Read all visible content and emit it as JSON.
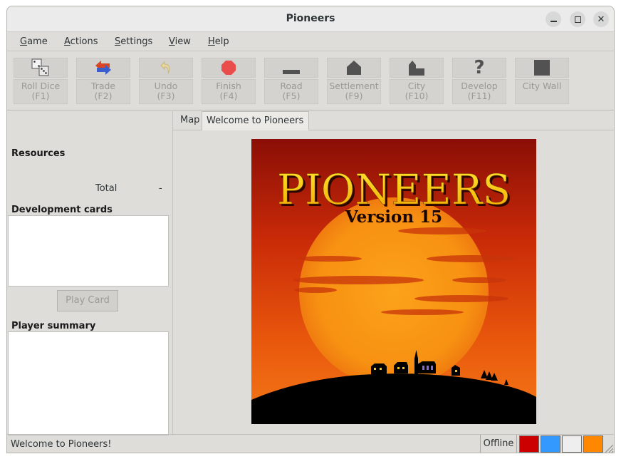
{
  "window": {
    "title": "Pioneers"
  },
  "menubar": {
    "items": [
      "Game",
      "Actions",
      "Settings",
      "View",
      "Help"
    ]
  },
  "toolbar": {
    "buttons": [
      {
        "line1": "Roll Dice",
        "line2": "(F1)",
        "icon": "dice-icon"
      },
      {
        "line1": "Trade",
        "line2": "(F2)",
        "icon": "trade-arrows-icon"
      },
      {
        "line1": "Undo",
        "line2": "(F3)",
        "icon": "undo-arrow-icon"
      },
      {
        "line1": "Finish",
        "line2": "(F4)",
        "icon": "stop-octagon-icon"
      },
      {
        "line1": "Road",
        "line2": "(F5)",
        "icon": "road-icon"
      },
      {
        "line1": "Settlement",
        "line2": "(F9)",
        "icon": "settlement-icon"
      },
      {
        "line1": "City",
        "line2": "(F10)",
        "icon": "city-icon"
      },
      {
        "line1": "Develop",
        "line2": "(F11)",
        "icon": "question-mark-icon"
      },
      {
        "line1": "City Wall",
        "line2": "",
        "icon": "city-wall-icon"
      }
    ]
  },
  "sidebar": {
    "resources_title": "Resources",
    "total_label": "Total",
    "total_value": "-",
    "dev_cards_title": "Development cards",
    "play_card_label": "Play Card",
    "player_summary_title": "Player summary"
  },
  "tabs": [
    "Map",
    "Welcome to Pioneers"
  ],
  "splash": {
    "title": "PIONEERS",
    "version": "Version 15"
  },
  "statusbar": {
    "message": "Welcome to Pioneers!",
    "connection": "Offline",
    "player_colors": [
      "#cc0000",
      "#3399ff",
      "#eeeeee",
      "#ff8800"
    ]
  }
}
